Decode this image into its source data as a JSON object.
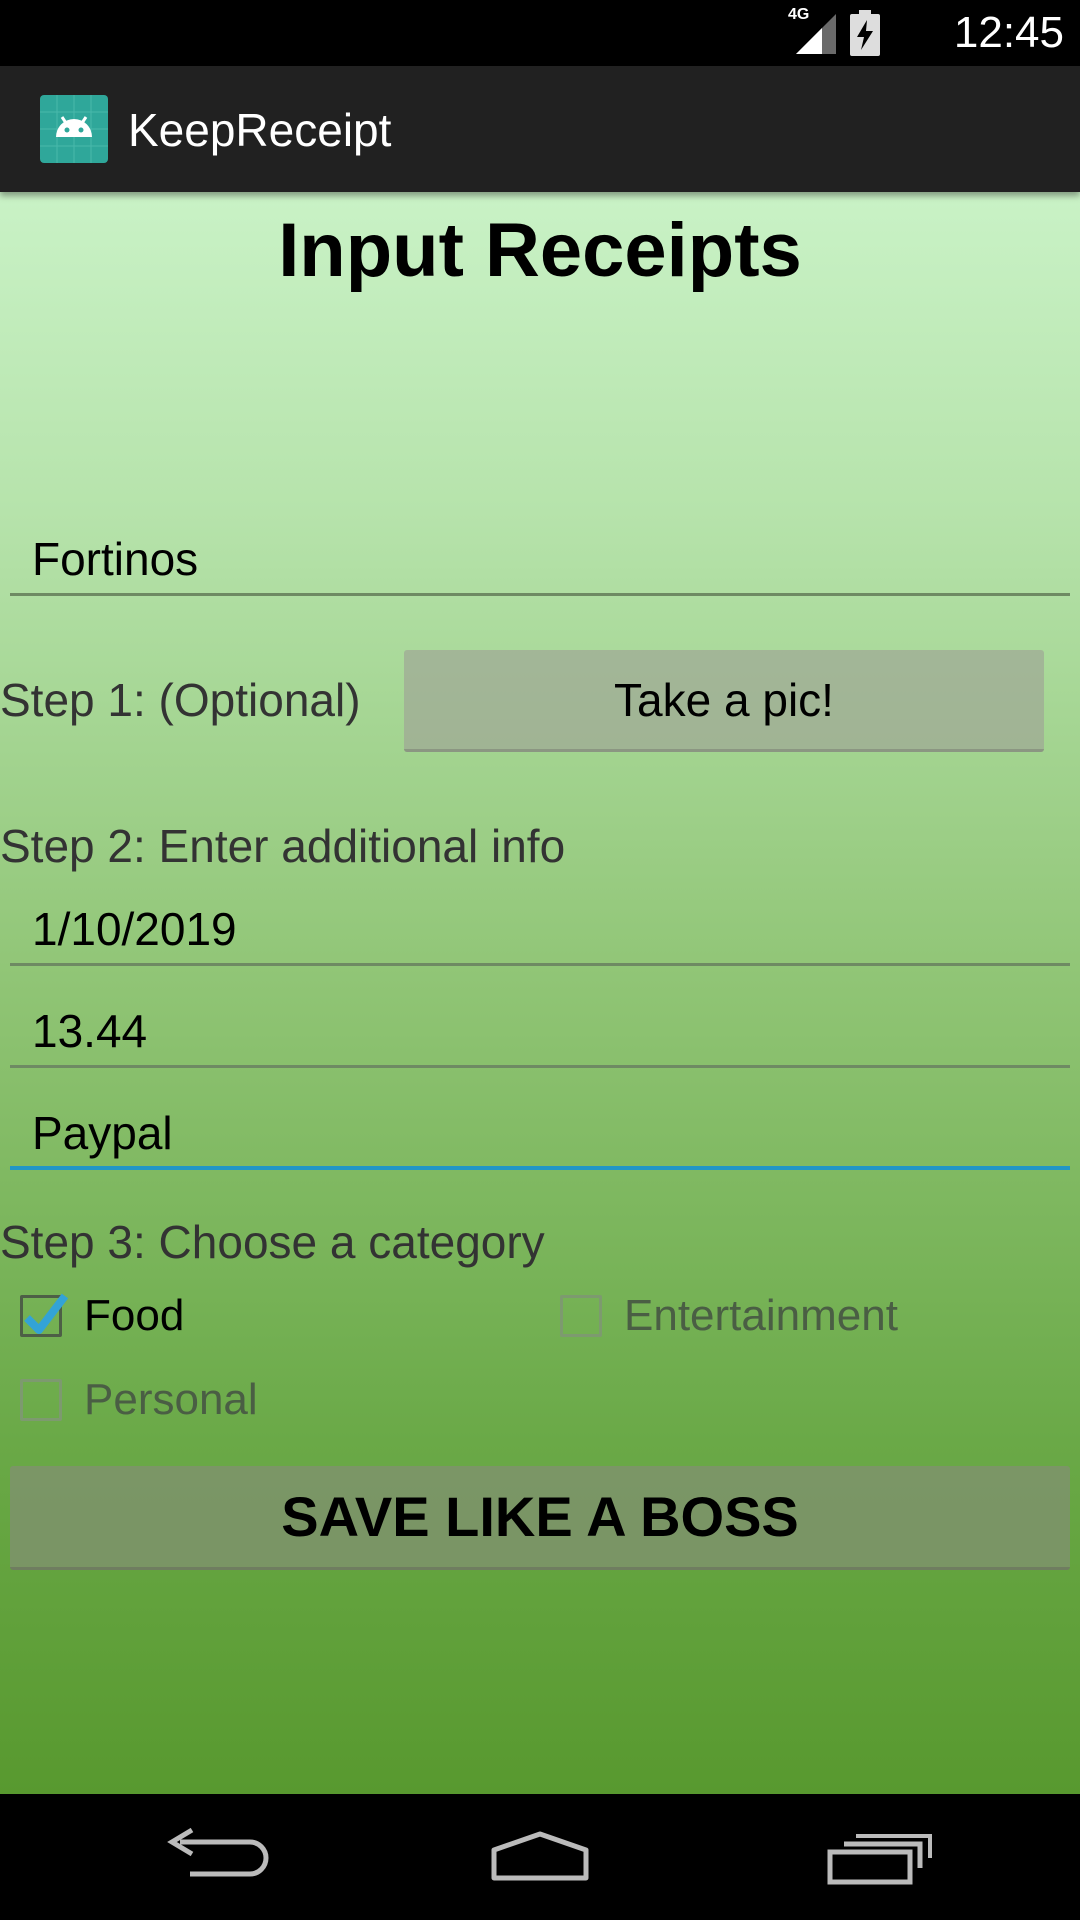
{
  "status_bar": {
    "network": "4G",
    "time": "12:45",
    "icons": [
      "signal-icon",
      "battery-charging-icon"
    ]
  },
  "action_bar": {
    "app_icon": "android-icon",
    "app_title": "KeepReceipt"
  },
  "main": {
    "title": "Input Receipts",
    "store_field": {
      "value": "Fortinos"
    },
    "step1": {
      "label": "Step 1: (Optional)",
      "button_label": "Take a pic!"
    },
    "step2": {
      "label": "Step 2: Enter additional info",
      "date_field": {
        "value": "1/10/2019"
      },
      "amount_field": {
        "value": "13.44"
      },
      "payment_field": {
        "value": "Paypal"
      }
    },
    "step3": {
      "label": "Step 3: Choose a category",
      "categories": [
        {
          "label": "Food",
          "checked": true
        },
        {
          "label": "Entertainment",
          "checked": false
        },
        {
          "label": "Personal",
          "checked": false
        }
      ]
    },
    "save_button_label": "SAVE LIKE A BOSS"
  },
  "nav_bar": {
    "buttons": [
      "back-icon",
      "home-icon",
      "recent-apps-icon"
    ]
  },
  "colors": {
    "accent": "#2196c6",
    "action_bar": "#212121",
    "app_icon": "#2fa79a"
  }
}
